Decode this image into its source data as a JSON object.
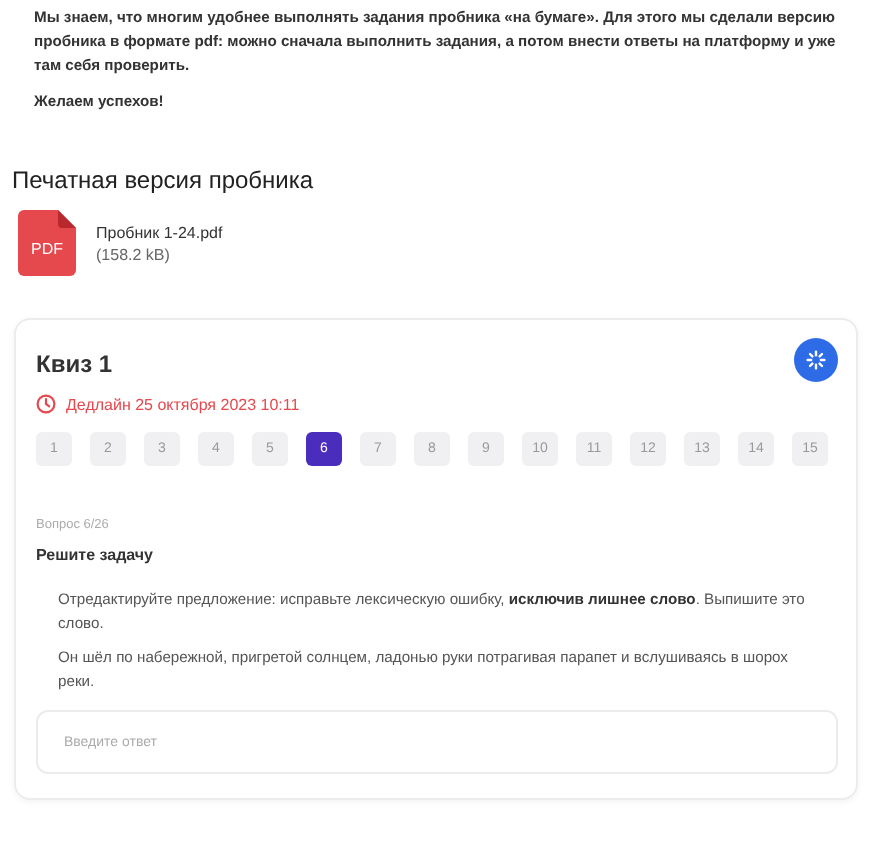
{
  "intro": {
    "paragraphs": [
      "Мы знаем, что многим удобнее выполнять задания пробника «на бумаге». Для этого мы сделали версию пробника в формате pdf: можно сначала выполнить задания, а потом внести ответы на платформу и уже там себя проверить.",
      "Желаем успехов!"
    ]
  },
  "print_section": {
    "title": "Печатная версия пробника",
    "file": {
      "badge": "PDF",
      "name": "Пробник 1-24.pdf",
      "size": "(158.2 kB)"
    }
  },
  "quiz": {
    "title": "Квиз 1",
    "deadline": "Дедлайн 25 октября 2023 10:11",
    "questions": [
      {
        "label": "1",
        "selected": false
      },
      {
        "label": "2",
        "selected": false
      },
      {
        "label": "3",
        "selected": false
      },
      {
        "label": "4",
        "selected": false
      },
      {
        "label": "5",
        "selected": false
      },
      {
        "label": "6",
        "selected": true
      },
      {
        "label": "7",
        "selected": false
      },
      {
        "label": "8",
        "selected": false
      },
      {
        "label": "9",
        "selected": false
      },
      {
        "label": "10",
        "selected": false
      },
      {
        "label": "11",
        "selected": false
      },
      {
        "label": "12",
        "selected": false
      },
      {
        "label": "13",
        "selected": false
      },
      {
        "label": "14",
        "selected": false
      },
      {
        "label": "15",
        "selected": false
      }
    ],
    "counter": "Вопрос 6/26",
    "question_title": "Решите задачу",
    "task": [
      "Отредактируйте предложение: исправьте лексическую ошибку, **исключив лишнее слово**. Выпишите это слово.",
      "Он шёл по набережной, пригретой солнцем, ладонью руки потрагивая парапет и вслушиваясь в шорох реки."
    ],
    "answer": {
      "placeholder": "Введите ответ"
    }
  }
}
